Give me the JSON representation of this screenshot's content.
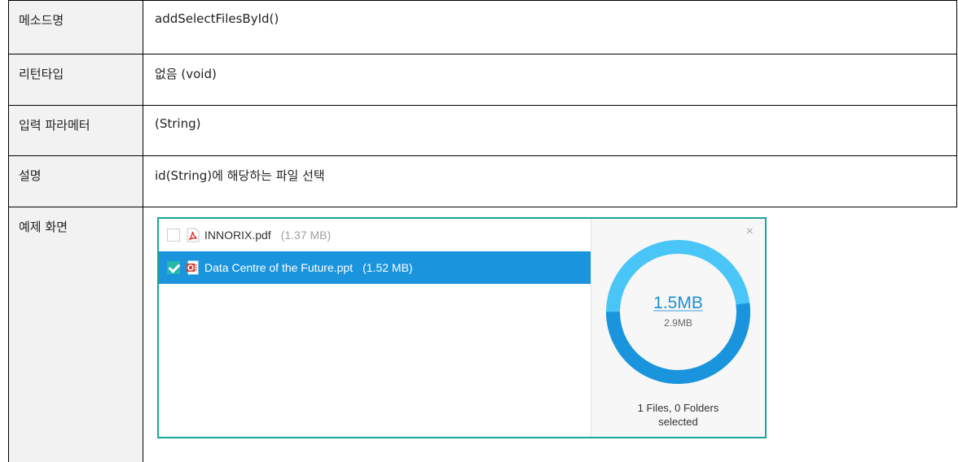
{
  "rows": {
    "method": {
      "label": "메소드명",
      "value": "addSelectFilesById()"
    },
    "return_type": {
      "label": "리턴타입",
      "value": "없음 (void)"
    },
    "params": {
      "label": "입력 파라메터",
      "value": "(String)"
    },
    "description": {
      "label": "설명",
      "value": "id(String)에 해당하는 파일 선택"
    },
    "example": {
      "label": "예제 화면"
    }
  },
  "widget": {
    "files": [
      {
        "name": "INNORIX.pdf",
        "size": "(1.37 MB)",
        "checked": false,
        "selected": false,
        "icon": "pdf-file-icon"
      },
      {
        "name": "Data Centre of the Future.ppt",
        "size": "(1.52 MB)",
        "checked": true,
        "selected": true,
        "icon": "ppt-file-icon"
      }
    ],
    "close_label": "×",
    "selected_size": "1.5MB",
    "total_size": "2.9MB",
    "selection_fraction": 0.52,
    "summary_line1": "1 Files, 0 Folders",
    "summary_line2": "selected",
    "colors": {
      "border": "#1aa595",
      "selected_row": "#1a94dc",
      "checkbox": "#25b8a8",
      "donut_selected": "#1a94dc",
      "donut_rest": "#49c5f7"
    }
  }
}
